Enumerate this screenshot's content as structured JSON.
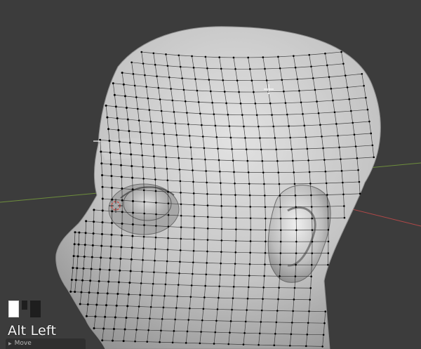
{
  "viewport": {
    "background": "#3c3c3c",
    "mesh_color": "#c6c6c6",
    "x_axis_color": "#b04848",
    "y_axis_color": "#6e8e3c",
    "vertex_color": "#000000",
    "cursor_icon": "crosshair-cursor-icon",
    "origin_icon": "3d-cursor-icon"
  },
  "screencast": {
    "mouse_buttons": [
      {
        "name": "left",
        "pressed": true,
        "color": "#ffffff"
      },
      {
        "name": "middle",
        "pressed": false,
        "color": "#1e1e1e"
      },
      {
        "name": "right",
        "pressed": false,
        "color": "#1e1e1e"
      }
    ],
    "key_label": "Alt Left"
  },
  "operator_panel": {
    "chevron_icon": "chevron-right-icon",
    "title": "Move"
  }
}
